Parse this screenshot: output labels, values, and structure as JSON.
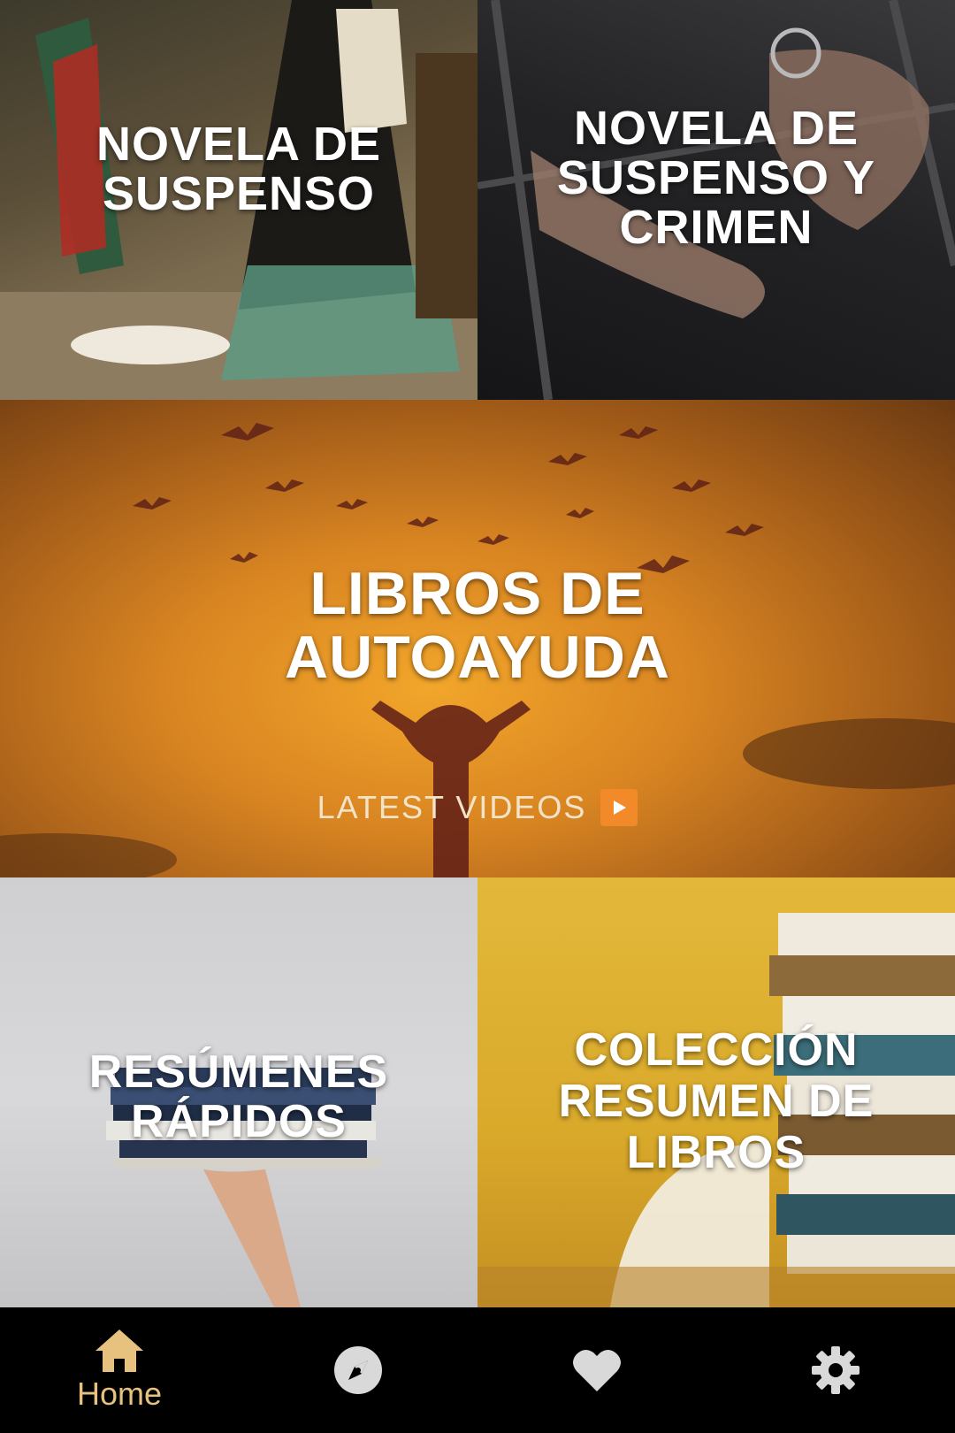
{
  "tiles": [
    {
      "title": "NOVELA DE\nSUSPENSO"
    },
    {
      "title": "NOVELA DE\nSUSPENSO Y\nCRIMEN"
    },
    {
      "title": "LIBROS DE\nAUTOAYUDA",
      "subtitle": "LATEST VIDEOS"
    },
    {
      "title": "RESÚMENES\nRÁPIDOS"
    },
    {
      "title": "COLECCIÓN\nRESUMEN DE\nLIBROS"
    }
  ],
  "play_icon": "play-button-icon",
  "bottom_nav": {
    "items": [
      {
        "icon": "home-icon",
        "label": "Home",
        "active": true
      },
      {
        "icon": "compass-icon",
        "active": false
      },
      {
        "icon": "heart-icon",
        "active": false
      },
      {
        "icon": "gear-icon",
        "active": false
      }
    ],
    "active_color": "#e7c27f",
    "inactive_color": "#d9d9d9"
  }
}
